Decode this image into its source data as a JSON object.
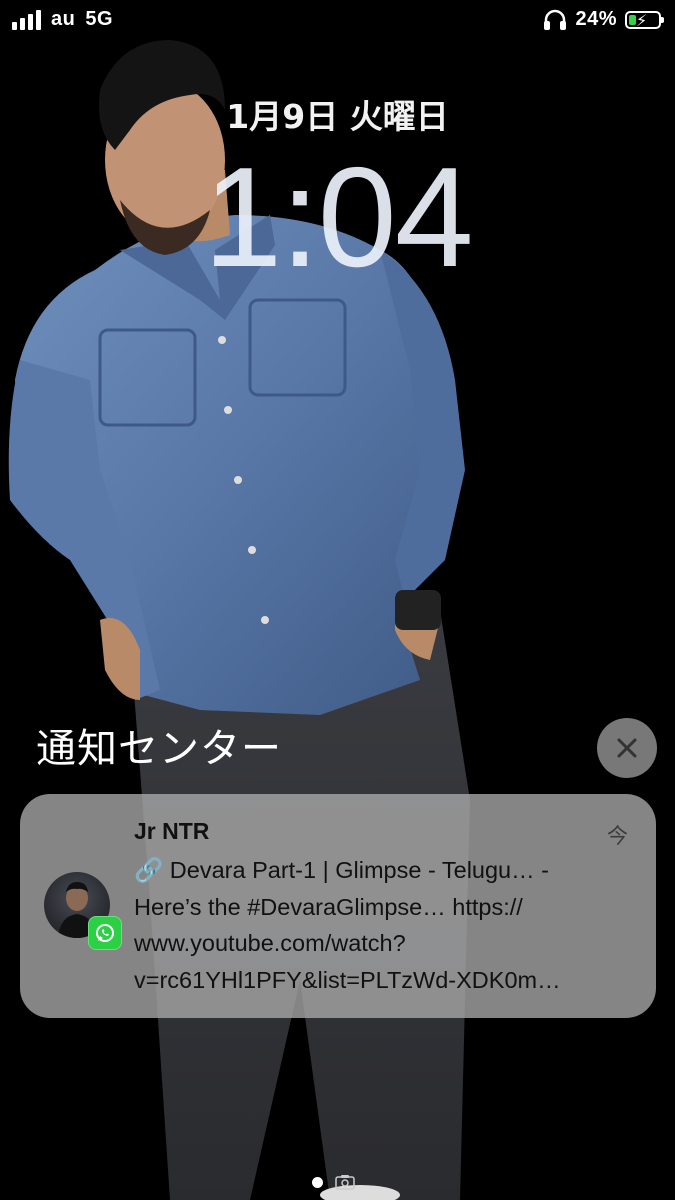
{
  "status_bar": {
    "carrier": "au",
    "network": "5G",
    "battery_percent": "24%",
    "battery_level": 0.24,
    "charging": true,
    "icons": [
      "signal-icon",
      "headphones-icon",
      "battery-charging-icon"
    ]
  },
  "lock_screen": {
    "date": "1月9日 火曜日",
    "time": "1:04"
  },
  "notification_center": {
    "title": "通知センター",
    "close_icon": "close-icon"
  },
  "notification": {
    "sender": "Jr NTR",
    "time": "今",
    "app_icon": "whatsapp-icon",
    "body_lines": [
      "🔗 Devara Part-1 | Glimpse - Telugu… -",
      "Here’s the #DevaraGlimpse… https://",
      "www.youtube.com/watch?",
      "v=rc61YHl1PFY&list=PLTzWd-XDK0m…"
    ]
  },
  "colors": {
    "background": "#000000",
    "battery_green": "#35d14b",
    "whatsapp_green": "#2bd045",
    "shirt_blue": "#5a7aa8"
  }
}
